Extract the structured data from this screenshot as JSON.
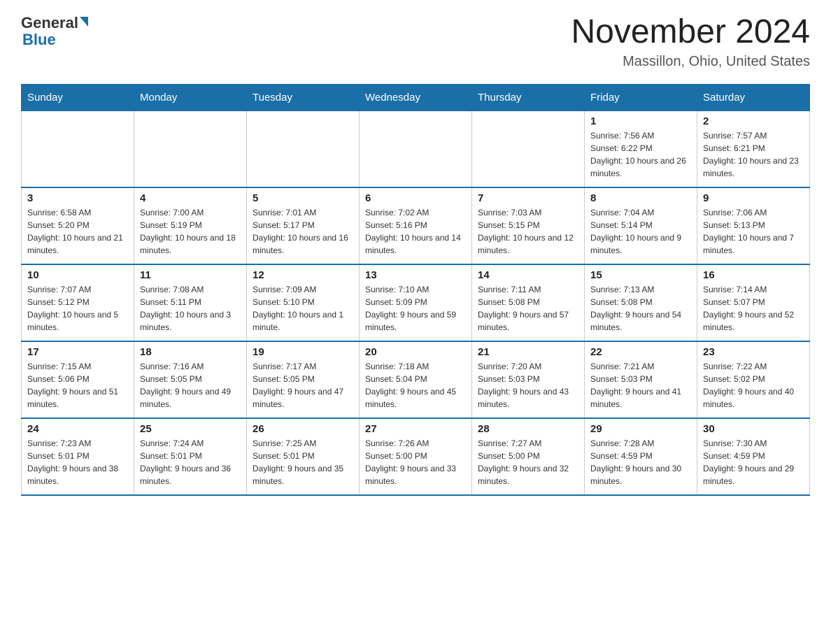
{
  "header": {
    "logo": {
      "general": "General",
      "blue": "Blue"
    },
    "title": "November 2024",
    "location": "Massillon, Ohio, United States"
  },
  "days_of_week": [
    "Sunday",
    "Monday",
    "Tuesday",
    "Wednesday",
    "Thursday",
    "Friday",
    "Saturday"
  ],
  "weeks": [
    [
      {
        "day": "",
        "info": ""
      },
      {
        "day": "",
        "info": ""
      },
      {
        "day": "",
        "info": ""
      },
      {
        "day": "",
        "info": ""
      },
      {
        "day": "",
        "info": ""
      },
      {
        "day": "1",
        "info": "Sunrise: 7:56 AM\nSunset: 6:22 PM\nDaylight: 10 hours and 26 minutes."
      },
      {
        "day": "2",
        "info": "Sunrise: 7:57 AM\nSunset: 6:21 PM\nDaylight: 10 hours and 23 minutes."
      }
    ],
    [
      {
        "day": "3",
        "info": "Sunrise: 6:58 AM\nSunset: 5:20 PM\nDaylight: 10 hours and 21 minutes."
      },
      {
        "day": "4",
        "info": "Sunrise: 7:00 AM\nSunset: 5:19 PM\nDaylight: 10 hours and 18 minutes."
      },
      {
        "day": "5",
        "info": "Sunrise: 7:01 AM\nSunset: 5:17 PM\nDaylight: 10 hours and 16 minutes."
      },
      {
        "day": "6",
        "info": "Sunrise: 7:02 AM\nSunset: 5:16 PM\nDaylight: 10 hours and 14 minutes."
      },
      {
        "day": "7",
        "info": "Sunrise: 7:03 AM\nSunset: 5:15 PM\nDaylight: 10 hours and 12 minutes."
      },
      {
        "day": "8",
        "info": "Sunrise: 7:04 AM\nSunset: 5:14 PM\nDaylight: 10 hours and 9 minutes."
      },
      {
        "day": "9",
        "info": "Sunrise: 7:06 AM\nSunset: 5:13 PM\nDaylight: 10 hours and 7 minutes."
      }
    ],
    [
      {
        "day": "10",
        "info": "Sunrise: 7:07 AM\nSunset: 5:12 PM\nDaylight: 10 hours and 5 minutes."
      },
      {
        "day": "11",
        "info": "Sunrise: 7:08 AM\nSunset: 5:11 PM\nDaylight: 10 hours and 3 minutes."
      },
      {
        "day": "12",
        "info": "Sunrise: 7:09 AM\nSunset: 5:10 PM\nDaylight: 10 hours and 1 minute."
      },
      {
        "day": "13",
        "info": "Sunrise: 7:10 AM\nSunset: 5:09 PM\nDaylight: 9 hours and 59 minutes."
      },
      {
        "day": "14",
        "info": "Sunrise: 7:11 AM\nSunset: 5:08 PM\nDaylight: 9 hours and 57 minutes."
      },
      {
        "day": "15",
        "info": "Sunrise: 7:13 AM\nSunset: 5:08 PM\nDaylight: 9 hours and 54 minutes."
      },
      {
        "day": "16",
        "info": "Sunrise: 7:14 AM\nSunset: 5:07 PM\nDaylight: 9 hours and 52 minutes."
      }
    ],
    [
      {
        "day": "17",
        "info": "Sunrise: 7:15 AM\nSunset: 5:06 PM\nDaylight: 9 hours and 51 minutes."
      },
      {
        "day": "18",
        "info": "Sunrise: 7:16 AM\nSunset: 5:05 PM\nDaylight: 9 hours and 49 minutes."
      },
      {
        "day": "19",
        "info": "Sunrise: 7:17 AM\nSunset: 5:05 PM\nDaylight: 9 hours and 47 minutes."
      },
      {
        "day": "20",
        "info": "Sunrise: 7:18 AM\nSunset: 5:04 PM\nDaylight: 9 hours and 45 minutes."
      },
      {
        "day": "21",
        "info": "Sunrise: 7:20 AM\nSunset: 5:03 PM\nDaylight: 9 hours and 43 minutes."
      },
      {
        "day": "22",
        "info": "Sunrise: 7:21 AM\nSunset: 5:03 PM\nDaylight: 9 hours and 41 minutes."
      },
      {
        "day": "23",
        "info": "Sunrise: 7:22 AM\nSunset: 5:02 PM\nDaylight: 9 hours and 40 minutes."
      }
    ],
    [
      {
        "day": "24",
        "info": "Sunrise: 7:23 AM\nSunset: 5:01 PM\nDaylight: 9 hours and 38 minutes."
      },
      {
        "day": "25",
        "info": "Sunrise: 7:24 AM\nSunset: 5:01 PM\nDaylight: 9 hours and 36 minutes."
      },
      {
        "day": "26",
        "info": "Sunrise: 7:25 AM\nSunset: 5:01 PM\nDaylight: 9 hours and 35 minutes."
      },
      {
        "day": "27",
        "info": "Sunrise: 7:26 AM\nSunset: 5:00 PM\nDaylight: 9 hours and 33 minutes."
      },
      {
        "day": "28",
        "info": "Sunrise: 7:27 AM\nSunset: 5:00 PM\nDaylight: 9 hours and 32 minutes."
      },
      {
        "day": "29",
        "info": "Sunrise: 7:28 AM\nSunset: 4:59 PM\nDaylight: 9 hours and 30 minutes."
      },
      {
        "day": "30",
        "info": "Sunrise: 7:30 AM\nSunset: 4:59 PM\nDaylight: 9 hours and 29 minutes."
      }
    ]
  ]
}
